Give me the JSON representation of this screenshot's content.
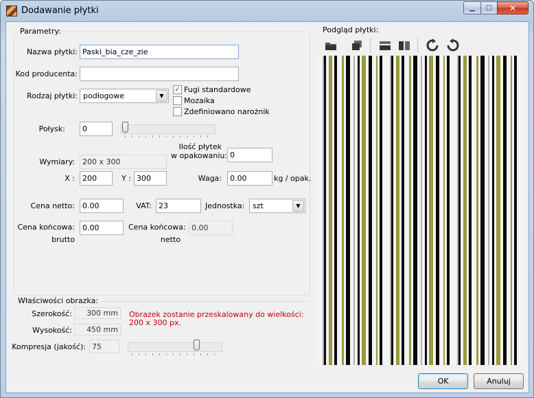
{
  "window": {
    "title": "Dodawanie płytki",
    "controls": {
      "minimize": "▁",
      "maximize": "▢",
      "close": "✕"
    }
  },
  "params": {
    "group_label": "Parametry:",
    "tile_name": {
      "label": "Nazwa płytki:",
      "value": "Paski_bia_cze_zie"
    },
    "producer_code": {
      "label": "Kod producenta:",
      "value": ""
    },
    "tile_type": {
      "label": "Rodzaj płytki:",
      "value": "podłogowe"
    },
    "checks": [
      {
        "label": "Fugi standardowe",
        "checked": true
      },
      {
        "label": "Mozaika",
        "checked": false
      },
      {
        "label": "Zdefiniowano narożnik",
        "checked": false
      }
    ],
    "gloss": {
      "label": "Połysk:",
      "value": "0",
      "level": 0
    },
    "dimensions": {
      "label": "Wymiary:",
      "value": "200 x 300"
    },
    "pack_qty": {
      "label_line1": "Ilość płytek",
      "label_line2": "w opakowaniu:",
      "value": "0"
    },
    "x": {
      "label": "X :",
      "value": "200"
    },
    "y": {
      "label": "Y :",
      "value": "300"
    },
    "weight": {
      "label": "Waga:",
      "value": "0.00",
      "unit": "kg / opak."
    },
    "net_price": {
      "label": "Cena netto:",
      "value": "0.00"
    },
    "vat": {
      "label": "VAT:",
      "value": "23"
    },
    "unit": {
      "label": "Jednostka:",
      "value": "szt"
    },
    "final_gross": {
      "label_line1": "Cena końcowa:",
      "label_line2": "brutto",
      "value": "0.00"
    },
    "final_net": {
      "label_line1": "Cena końcowa:",
      "label_line2": "netto",
      "value": "0.00"
    }
  },
  "image_props": {
    "group_label": "Właściwości obrazka:",
    "width": {
      "label": "Szerokość:",
      "value": "300 mm"
    },
    "height": {
      "label": "Wysokość:",
      "value": "450 mm"
    },
    "compression": {
      "label": "Kompresja (jakość):",
      "value": "75",
      "level": 0.75
    },
    "notice_line1": "Obrazek zostanie przeskalowany do wielkości:",
    "notice_line2": "200 x 300 px."
  },
  "preview": {
    "group_label": "Podgląd płytki:",
    "tools": [
      "open-icon",
      "copy-icon",
      "flip-horizontal-icon",
      "flip-vertical-icon",
      "rotate-right-icon",
      "rotate-left-icon"
    ]
  },
  "buttons": {
    "ok": "OK",
    "cancel": "Anuluj"
  },
  "colors": {
    "stripe_black": "#0a0a0a",
    "stripe_white": "#f4f4f4",
    "stripe_green": "#9a9a3a",
    "stripe_gray": "#b0b0b0",
    "error_text": "#c00000"
  }
}
